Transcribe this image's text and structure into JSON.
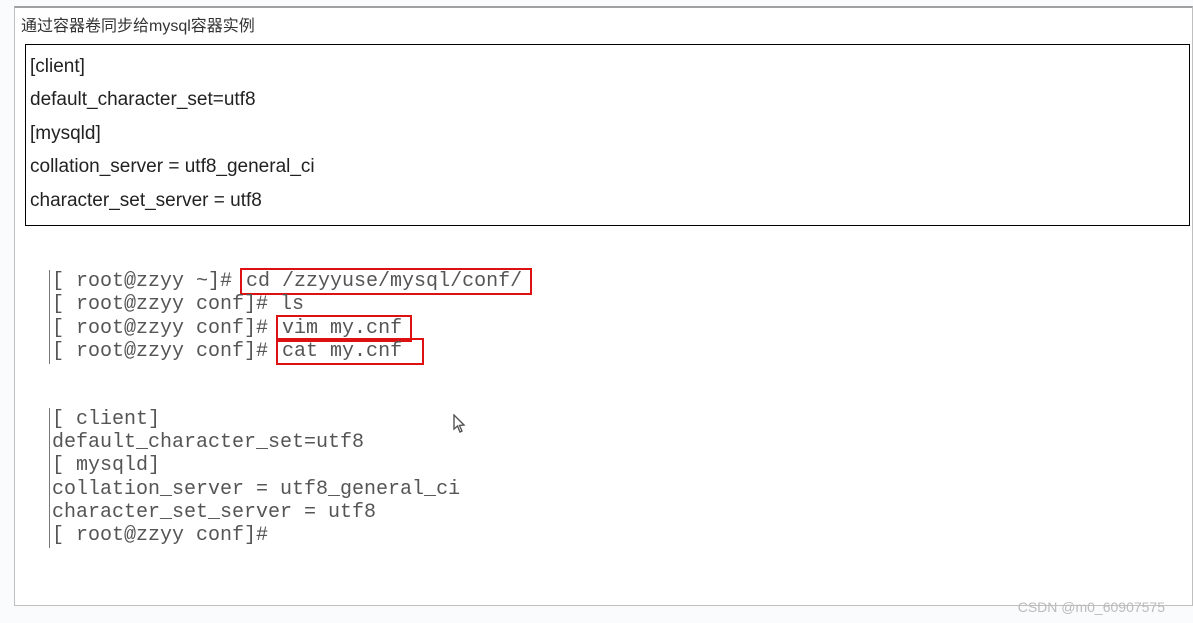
{
  "tab": {
    "label": "通过容器卷同步给mysql容器实例"
  },
  "configBox": {
    "line1": "[client]",
    "line2": "default_character_set=utf8",
    "line3": "[mysqld]",
    "line4": "collation_server = utf8_general_ci",
    "line5": "character_set_server = utf8"
  },
  "terminal": {
    "prompt1": "[ root@zzyy ~]# ",
    "cmd1": "cd /zzyyuse/mysql/conf/",
    "prompt2": "[ root@zzyy conf]# ",
    "cmd2": "ls",
    "prompt3": "[ root@zzyy conf]# ",
    "cmd3": "vim my.cnf",
    "prompt4": "[ root@zzyy conf]# ",
    "cmd4": "cat my.cnf "
  },
  "output": {
    "l1": "[ client]",
    "l2": "default_character_set=utf8",
    "l3": "[ mysqld]",
    "l4": "collation_server = utf8_general_ci",
    "l5": "character_set_server = utf8",
    "l6": "[ root@zzyy conf]#"
  },
  "watermark": "CSDN @m0_60907575"
}
